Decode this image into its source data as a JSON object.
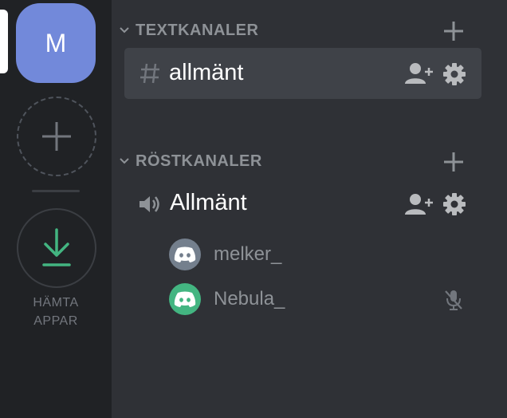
{
  "servers": {
    "active_server_initial": "M",
    "download_label_line1": "HÄMTA",
    "download_label_line2": "APPAR"
  },
  "text_category": {
    "label": "TEXTKANALER"
  },
  "text_channels": [
    {
      "name": "allmänt",
      "selected": true
    }
  ],
  "voice_category": {
    "label": "RÖSTKANALER"
  },
  "voice_channels": [
    {
      "name": "Allmänt"
    }
  ],
  "voice_users": [
    {
      "name": "melker_",
      "avatar_color": "#747f8d",
      "muted": false
    },
    {
      "name": "Nebula_",
      "avatar_color": "#43b581",
      "muted": true
    }
  ],
  "colors": {
    "blurple": "#7289da",
    "green": "#43b581",
    "grey_avatar": "#747f8d"
  }
}
